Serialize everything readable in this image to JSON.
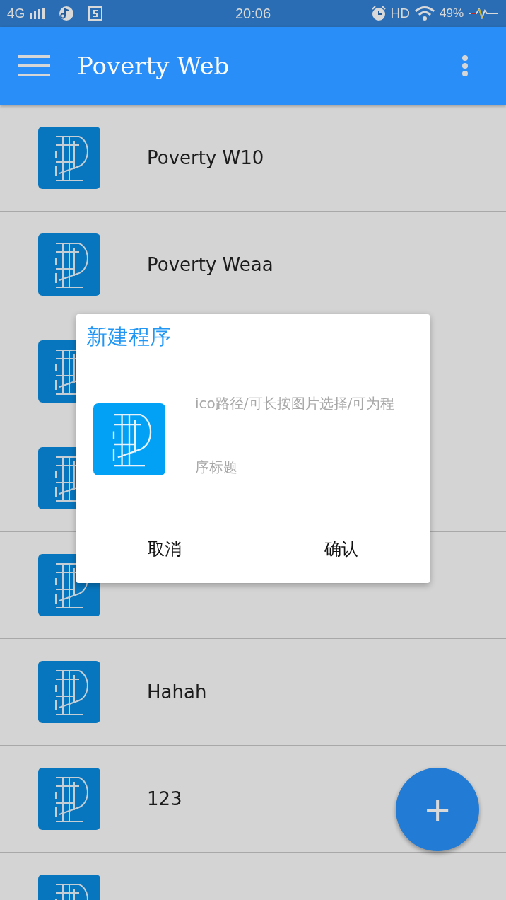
{
  "status_bar": {
    "network": "4G",
    "time": "20:06",
    "hd": "HD",
    "battery": "49%"
  },
  "toolbar": {
    "title": "Poverty Web"
  },
  "list": {
    "items": [
      {
        "kind": "titled",
        "title": "Poverty W10"
      },
      {
        "kind": "titled",
        "title": "Poverty Weaa"
      },
      {
        "kind": "covered"
      },
      {
        "kind": "covered"
      },
      {
        "kind": "blank"
      },
      {
        "kind": "titled",
        "title": "Hahah"
      },
      {
        "kind": "titled",
        "title": "123"
      },
      {
        "kind": "blank"
      }
    ]
  },
  "dialog": {
    "title": "新建程序",
    "field": {
      "placeholder": "ico路径/可长按图片选择/可为程序标题"
    },
    "buttons": [
      {
        "label": "取消"
      },
      {
        "label": "确认"
      }
    ]
  },
  "fab": {
    "label": "+"
  }
}
